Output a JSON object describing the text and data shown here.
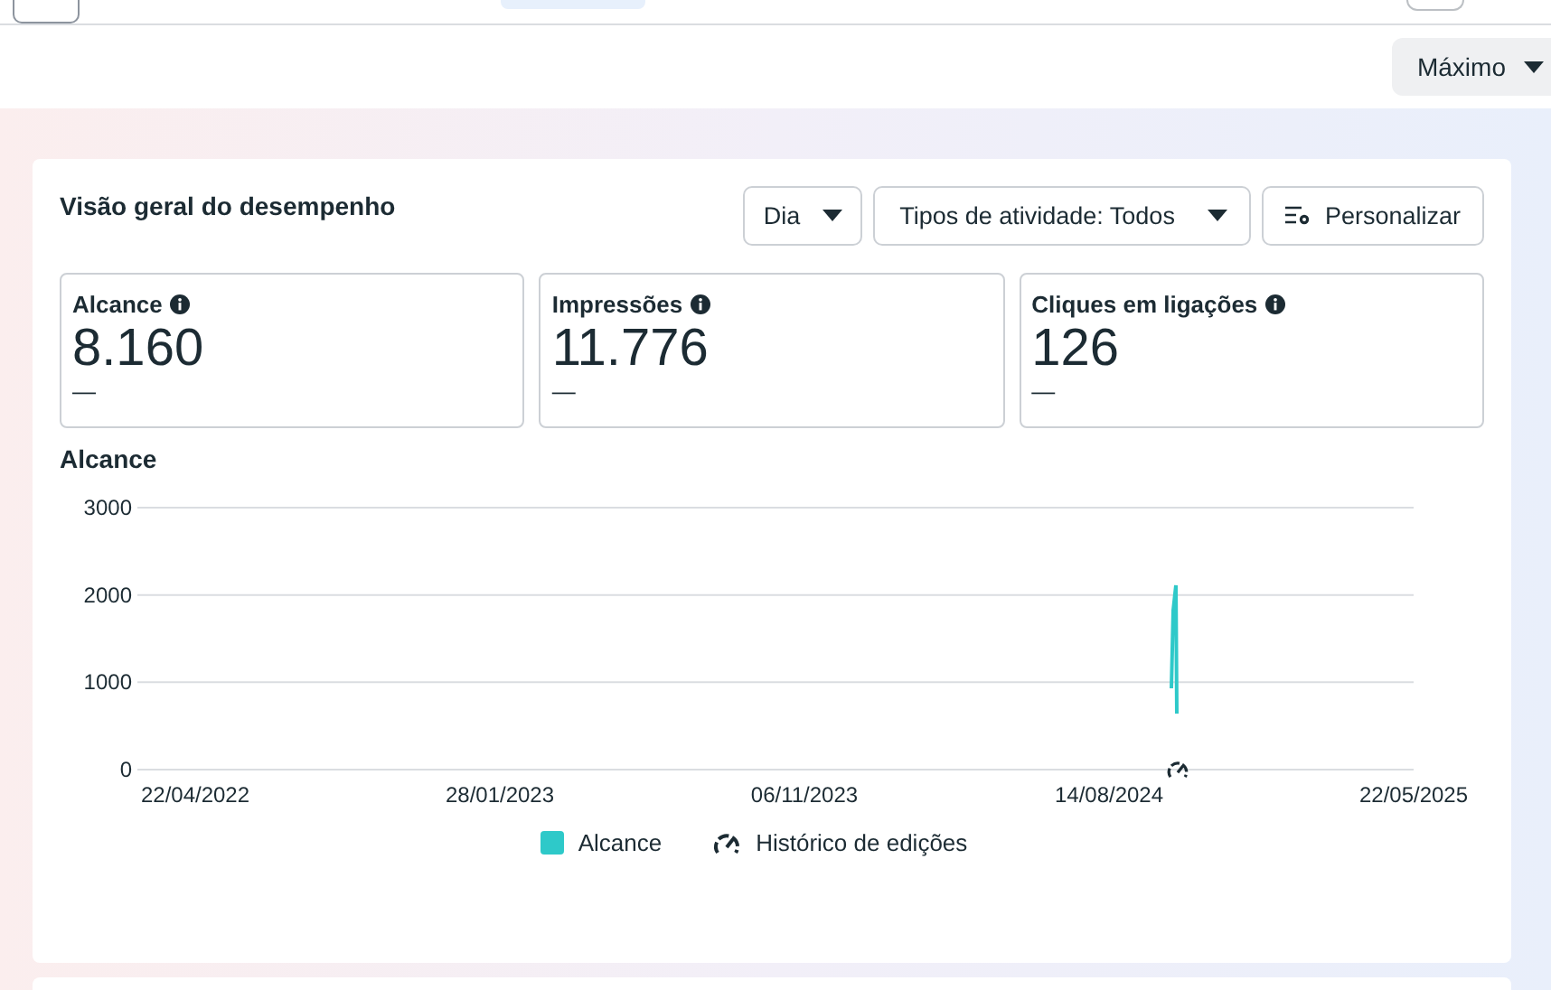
{
  "header": {
    "range_dropdown": {
      "label": "Máximo"
    }
  },
  "overview": {
    "title": "Visão geral do desempenho",
    "controls": {
      "period_dropdown": "Dia",
      "activity_dropdown": "Tipos de atividade: Todos",
      "customize_button": "Personalizar"
    },
    "metrics": [
      {
        "label": "Alcance",
        "value": "8.160",
        "change": "—"
      },
      {
        "label": "Impressões",
        "value": "11.776",
        "change": "—"
      },
      {
        "label": "Cliques em ligações",
        "value": "126",
        "change": "—"
      }
    ],
    "chart_title": "Alcance",
    "chart": {
      "y_axis_labels": [
        "3000",
        "2000",
        "1000",
        "0"
      ],
      "x_axis_labels": [
        "22/04/2022",
        "28/01/2023",
        "06/11/2023",
        "14/08/2024",
        "22/05/2025"
      ]
    },
    "legend": [
      {
        "kind": "swatch",
        "label": "Alcance",
        "color": "#2ec9c9"
      },
      {
        "kind": "gauge",
        "label": "Histórico de edições"
      }
    ]
  }
}
